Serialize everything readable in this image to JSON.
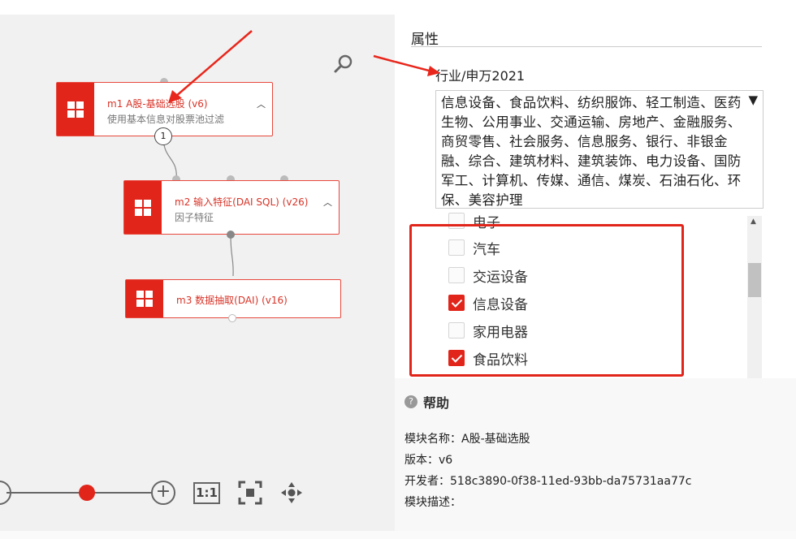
{
  "canvas": {
    "nodes": [
      {
        "title": "m1 A股-基础选股 (v6)",
        "subtitle": "使用基本信息对股票池过滤"
      },
      {
        "title": "m2 输入特征(DAI SQL) (v26)",
        "subtitle": "因子特征"
      },
      {
        "title": "m3 数据抽取(DAI) (v16)",
        "subtitle": ""
      }
    ],
    "port_badge": "1",
    "zoom_reset_label": "1:1",
    "zoom_level": 0.55,
    "icons": {
      "search": "search-icon",
      "zoom_out": "zoom-out-icon",
      "zoom_in": "zoom-in-icon",
      "fit": "fit-to-screen-icon",
      "pan": "pan-icon",
      "node": "module-icon",
      "collapse": "chevron-up-icon"
    }
  },
  "properties": {
    "title": "属性",
    "field_label": "行业/申万2021",
    "selected_text": "信息设备、食品饮料、纺织服饰、轻工制造、医药生物、公用事业、交通运输、房地产、金融服务、商贸零售、社会服务、信息服务、银行、非银金融、综合、建筑材料、建筑装饰、电力设备、国防军工、计算机、传媒、通信、煤炭、石油石化、环保、美容护理",
    "dropdown_arrow": "▼",
    "options": [
      {
        "label": "电子",
        "checked": false
      },
      {
        "label": "汽车",
        "checked": false
      },
      {
        "label": "交运设备",
        "checked": false
      },
      {
        "label": "信息设备",
        "checked": true
      },
      {
        "label": "家用电器",
        "checked": false
      },
      {
        "label": "食品饮料",
        "checked": true
      }
    ]
  },
  "help": {
    "title": "帮助",
    "q": "?",
    "module_name": "模块名称：A股-基础选股",
    "version": "版本：v6",
    "developer": "开发者：518c3890-0f38-11ed-93bb-da75731aa77c",
    "description": "模块描述："
  },
  "colors": {
    "accent": "#e1251b",
    "annotation": "#e8261b"
  }
}
